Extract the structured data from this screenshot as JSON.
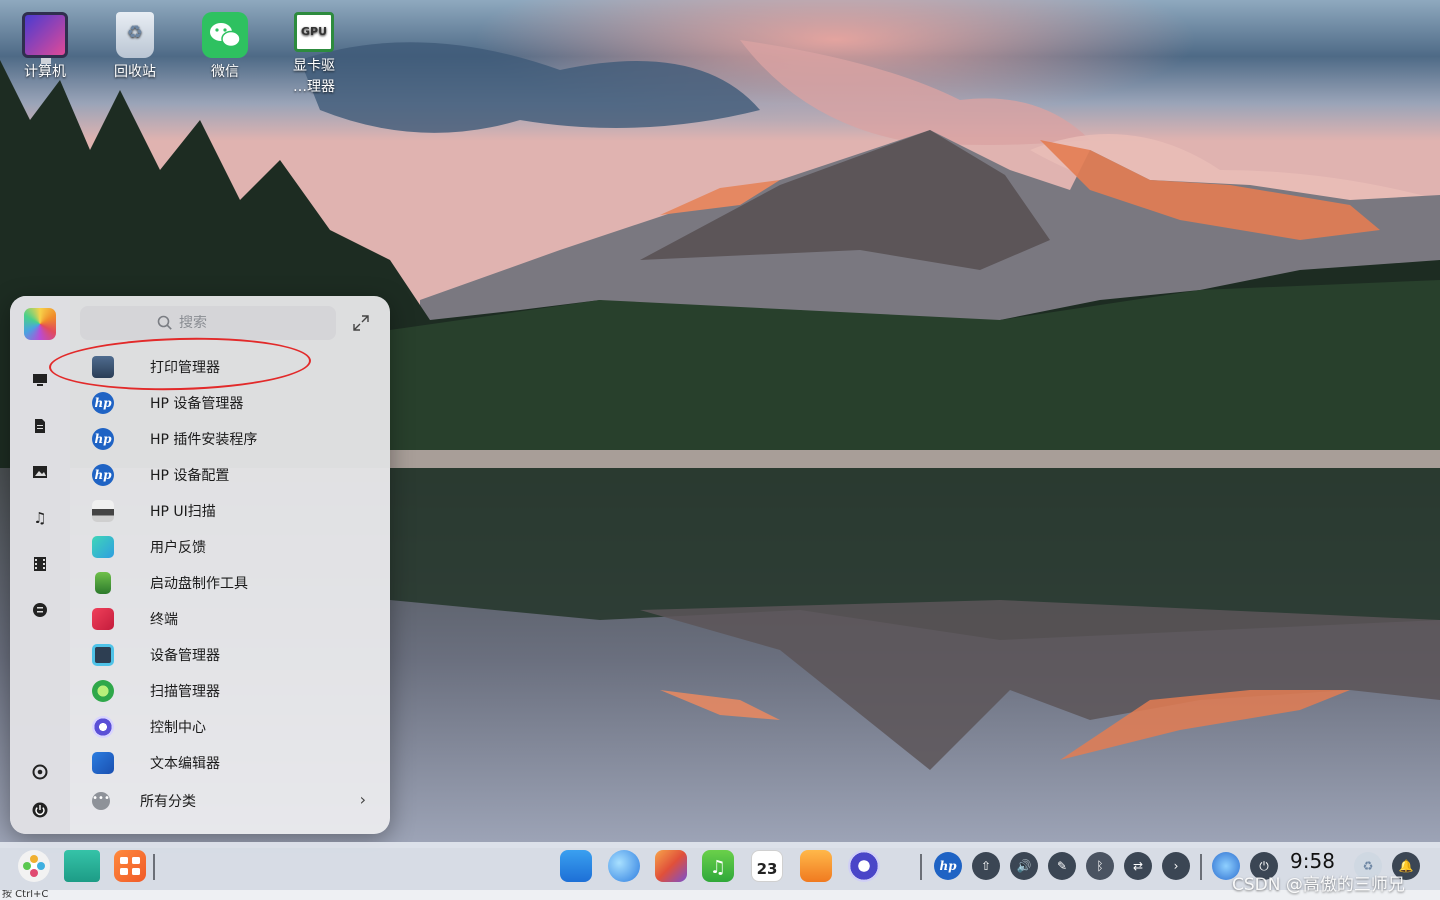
{
  "desktop": {
    "icons": [
      {
        "label": "计算机"
      },
      {
        "label": "回收站"
      },
      {
        "label": "微信"
      },
      {
        "label": "显卡驱\n…理器"
      }
    ],
    "gpu_badge": "GPU"
  },
  "start_menu": {
    "search_placeholder": "搜索",
    "apps": [
      {
        "label": "打印管理器",
        "icon": "printer-manager-icon"
      },
      {
        "label": "HP 设备管理器",
        "icon": "hp-icon"
      },
      {
        "label": "HP 插件安装程序",
        "icon": "hp-icon"
      },
      {
        "label": "HP 设备配置",
        "icon": "hp-icon"
      },
      {
        "label": "HP UI扫描",
        "icon": "scanner-icon"
      },
      {
        "label": "用户反馈",
        "icon": "feedback-icon"
      },
      {
        "label": "启动盘制作工具",
        "icon": "boot-disk-icon"
      },
      {
        "label": "终端",
        "icon": "terminal-icon"
      },
      {
        "label": "设备管理器",
        "icon": "device-manager-icon"
      },
      {
        "label": "扫描管理器",
        "icon": "scan-manager-icon"
      },
      {
        "label": "控制中心",
        "icon": "control-center-icon"
      },
      {
        "label": "文本编辑器",
        "icon": "text-editor-icon"
      }
    ],
    "all_categories": "所有分类",
    "hp_glyph": "hp"
  },
  "taskbar": {
    "clock": "9:58",
    "calendar_day": "23",
    "bottom_text": "按 Ctrl+C"
  },
  "watermark": "CSDN @高傲的三师兄"
}
